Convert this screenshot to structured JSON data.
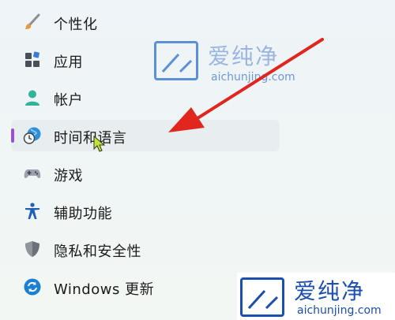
{
  "nav": {
    "items": [
      {
        "label": "个性化",
        "icon": "brush-icon"
      },
      {
        "label": "应用",
        "icon": "apps-icon"
      },
      {
        "label": "帐户",
        "icon": "person-icon"
      },
      {
        "label": "时间和语言",
        "icon": "clock-globe-icon",
        "selected": true
      },
      {
        "label": "游戏",
        "icon": "gamepad-icon"
      },
      {
        "label": "辅助功能",
        "icon": "accessibility-icon"
      },
      {
        "label": "隐私和安全性",
        "icon": "shield-icon"
      },
      {
        "label": "Windows 更新",
        "icon": "update-icon"
      }
    ]
  },
  "watermark": {
    "brand": "爱纯净",
    "url": "aichunjing.com"
  },
  "colors": {
    "accent": "#9b4fd1",
    "arrow": "#e0261f",
    "watermark": "#5b8fd8"
  }
}
